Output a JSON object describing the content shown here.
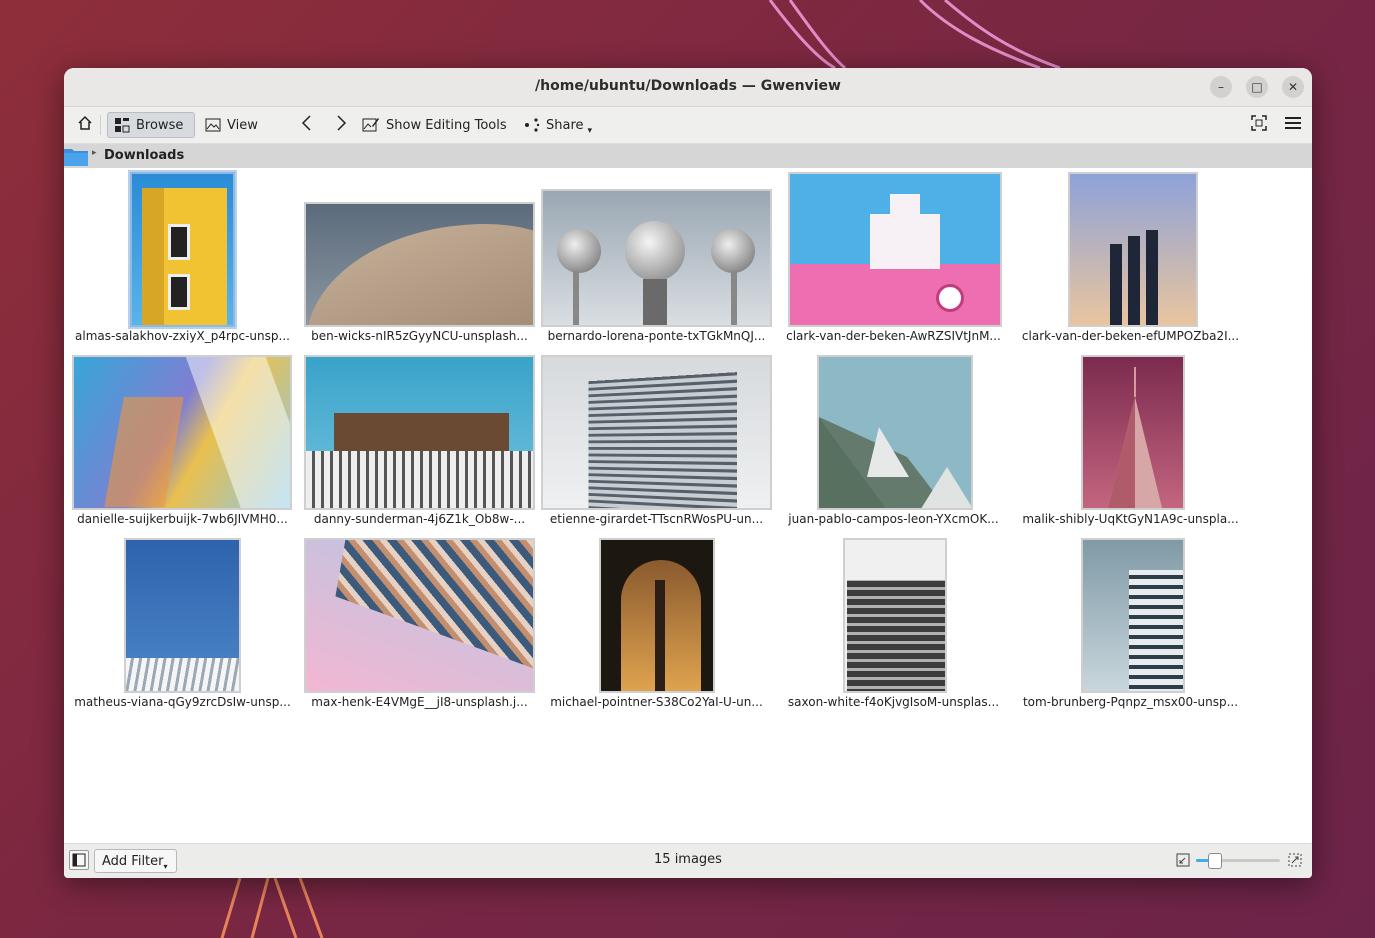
{
  "window": {
    "title": "/home/ubuntu/Downloads — Gwenview"
  },
  "toolbar": {
    "browse_label": "Browse",
    "view_label": "View",
    "editing_label": "Show Editing Tools",
    "share_label": "Share"
  },
  "breadcrumb": {
    "folder": "Downloads"
  },
  "files": [
    {
      "name": "almas-salakhov-zxiyX_p4rpc-unsp..."
    },
    {
      "name": "ben-wicks-nIR5zGyyNCU-unsplash..."
    },
    {
      "name": "bernardo-lorena-ponte-txTGkMnQJ..."
    },
    {
      "name": "clark-van-der-beken-AwRZSIVtJnM..."
    },
    {
      "name": "clark-van-der-beken-efUMPOZba2I..."
    },
    {
      "name": "danielle-suijkerbuijk-7wb6JIVMH0..."
    },
    {
      "name": "danny-sunderman-4j6Z1k_Ob8w-..."
    },
    {
      "name": "etienne-girardet-TTscnRWosPU-un..."
    },
    {
      "name": "juan-pablo-campos-leon-YXcmOK..."
    },
    {
      "name": "malik-shibly-UqKtGyN1A9c-unspla..."
    },
    {
      "name": "matheus-viana-qGy9zrcDsIw-unsp..."
    },
    {
      "name": "max-henk-E4VMgE__jI8-unsplash.j..."
    },
    {
      "name": "michael-pointner-S38Co2YaI-U-un..."
    },
    {
      "name": "saxon-white-f4oKjvgIsoM-unsplas..."
    },
    {
      "name": "tom-brunberg-Pqnpz_msx00-unsp..."
    }
  ],
  "statusbar": {
    "add_filter_label": "Add Filter",
    "count": "15 images",
    "zoom_fraction": 0.22
  },
  "colors": {
    "accent": "#3daee9",
    "selection": "#b6d0ee"
  }
}
